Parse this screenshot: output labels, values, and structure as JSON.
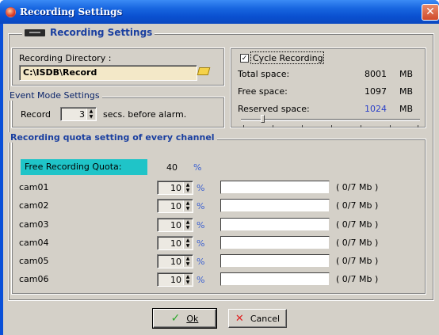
{
  "window": {
    "title": "Recording Settings",
    "close_glyph": "✕"
  },
  "group": {
    "title": "Recording  Settings",
    "icon": "hard-drive-icon"
  },
  "directory": {
    "label": "Recording Directory :",
    "value": "C:\\ISDB\\Record",
    "browse_icon": "folder-icon"
  },
  "event_mode": {
    "title": "Event Mode Settings",
    "record_label": "Record",
    "seconds_value": "3",
    "suffix": "secs. before alarm."
  },
  "cycle": {
    "label": "Cycle Recording",
    "checked": true,
    "total_label": "Total space:",
    "total_value": "8001",
    "free_label": "Free space:",
    "free_value": "1097",
    "reserved_label": "Reserved space:",
    "reserved_value": "1024",
    "unit": "MB",
    "reserved_color": "#2a3fc8"
  },
  "quota": {
    "title": "Recording quota setting of every channel",
    "free_label": "Free Recording Quota:",
    "free_value": "40",
    "percent": "%",
    "free_bg": "#1fc4c8",
    "cameras": [
      {
        "name": "cam01",
        "value": "10",
        "usage": "( 0/7 Mb )"
      },
      {
        "name": "cam02",
        "value": "10",
        "usage": "( 0/7 Mb )"
      },
      {
        "name": "cam03",
        "value": "10",
        "usage": "( 0/7 Mb )"
      },
      {
        "name": "cam04",
        "value": "10",
        "usage": "( 0/7 Mb )"
      },
      {
        "name": "cam05",
        "value": "10",
        "usage": "( 0/7 Mb )"
      },
      {
        "name": "cam06",
        "value": "10",
        "usage": "( 0/7 Mb )"
      }
    ]
  },
  "buttons": {
    "ok_label": "Ok",
    "cancel_label": "Cancel"
  }
}
